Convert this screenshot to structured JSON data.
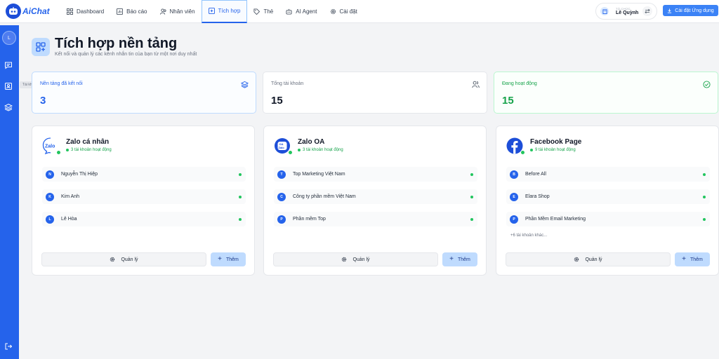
{
  "app": {
    "logo_text": "AiChat"
  },
  "nav": {
    "items": [
      {
        "label": "Dashboard",
        "icon": "grid-icon"
      },
      {
        "label": "Báo cáo",
        "icon": "report-icon"
      },
      {
        "label": "Nhân viên",
        "icon": "users-icon"
      },
      {
        "label": "Tích hợp",
        "icon": "integration-icon",
        "active": true
      },
      {
        "label": "Thẻ",
        "icon": "tag-icon"
      },
      {
        "label": "AI Agent",
        "icon": "robot-icon"
      },
      {
        "label": "Cài đặt",
        "icon": "gear-icon"
      }
    ]
  },
  "org": {
    "label": "TỔ CHỨC",
    "name": "Lê Quỳnh"
  },
  "install_label": "Cài đặt Ứng dụng",
  "sidebar": {
    "avatar": "L",
    "tooltip": "Tài khoản"
  },
  "page": {
    "title": "Tích hợp nền tảng",
    "subtitle": "Kết nối và quản lý các kênh nhắn tin của bạn từ một nơi duy nhất"
  },
  "stats": [
    {
      "label": "Nền tảng đã kết nối",
      "value": "3"
    },
    {
      "label": "Tổng tài khoản",
      "value": "15"
    },
    {
      "label": "Đang hoạt động",
      "value": "15"
    }
  ],
  "platforms": [
    {
      "title": "Zalo cá nhân",
      "subtitle": "3 tài khoản hoạt động",
      "accounts": [
        {
          "initial": "N",
          "name": "Nguyễn Thị Hiệp"
        },
        {
          "initial": "K",
          "name": "Kim Anh"
        },
        {
          "initial": "L",
          "name": "Lê Hòa"
        }
      ],
      "more": "",
      "manage_label": "Quản lý",
      "add_label": "Thêm"
    },
    {
      "title": "Zalo OA",
      "subtitle": "3 tài khoản hoạt động",
      "accounts": [
        {
          "initial": "T",
          "name": "Top Marketing Việt Nam"
        },
        {
          "initial": "C",
          "name": "Công ty phần mềm Việt Nam"
        },
        {
          "initial": "P",
          "name": "Phần mềm Top"
        }
      ],
      "more": "",
      "manage_label": "Quản lý",
      "add_label": "Thêm"
    },
    {
      "title": "Facebook Page",
      "subtitle": "9 tài khoản hoạt động",
      "accounts": [
        {
          "initial": "B",
          "name": "Before All"
        },
        {
          "initial": "E",
          "name": "Elara Shop"
        },
        {
          "initial": "P",
          "name": "Phần Mềm Email Marketing"
        }
      ],
      "more": "+6 tài khoản khác...",
      "manage_label": "Quản lý",
      "add_label": "Thêm"
    }
  ],
  "colors": {
    "primary": "#2563eb",
    "success": "#22c55e",
    "accent_light": "#bfdbfe"
  }
}
